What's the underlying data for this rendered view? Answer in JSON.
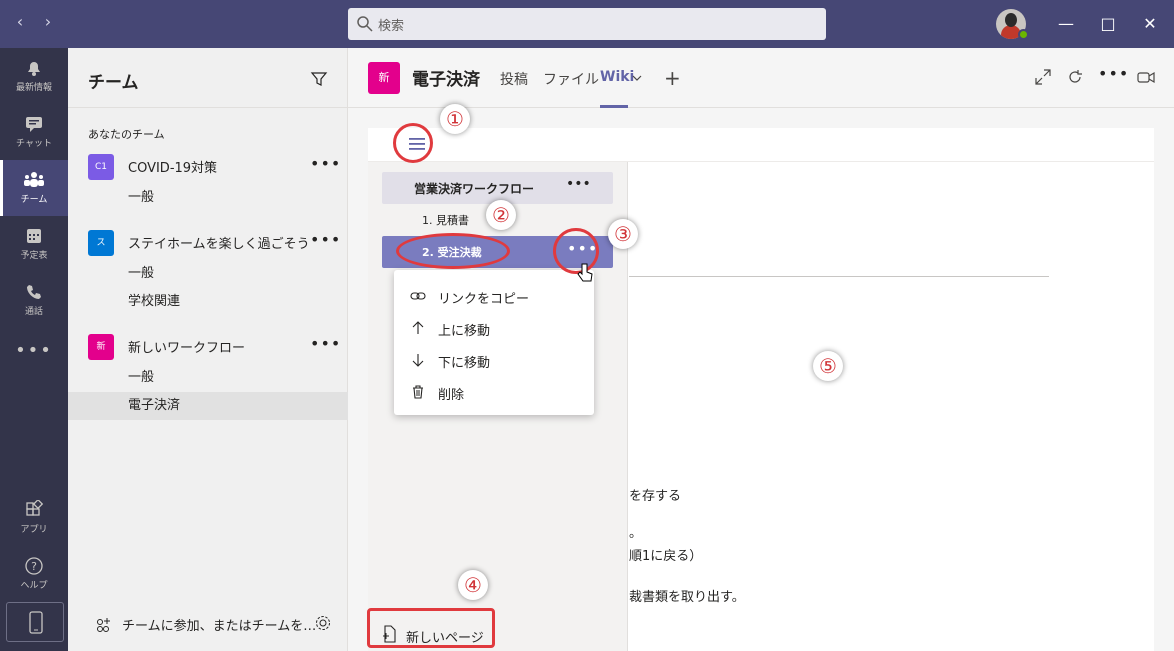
{
  "titlebar": {
    "search_placeholder": "検索",
    "colors": {
      "bar": "#464775"
    }
  },
  "rail": {
    "items": [
      {
        "label": "最新情報",
        "icon": "bell-icon"
      },
      {
        "label": "チャット",
        "icon": "chat-icon"
      },
      {
        "label": "チーム",
        "icon": "teams-icon"
      },
      {
        "label": "予定表",
        "icon": "calendar-icon"
      },
      {
        "label": "通話",
        "icon": "phone-icon"
      },
      {
        "label": "アプリ",
        "icon": "apps-icon"
      },
      {
        "label": "ヘルプ",
        "icon": "help-icon"
      }
    ],
    "active": "チーム"
  },
  "teams_panel": {
    "title": "チーム",
    "section_label": "あなたのチーム",
    "teams": [
      {
        "badge": "C1",
        "badge_color": "#7b5be5",
        "name": "COVID-19対策",
        "channels": [
          "一般"
        ]
      },
      {
        "badge": "ス",
        "badge_color": "#0078d4",
        "name": "ステイホームを楽しく過ごそう",
        "channels": [
          "一般",
          "学校関連"
        ]
      },
      {
        "badge": "新",
        "badge_color": "#e3008c",
        "name": "新しいワークフロー",
        "channels": [
          "一般",
          "電子決済"
        ]
      }
    ],
    "selected_channel": "電子決済",
    "footer_text": "チームに参加、またはチームを…"
  },
  "main_header": {
    "badge": "新",
    "channel_title": "電子決済",
    "tabs": [
      {
        "label": "投稿"
      },
      {
        "label": "ファイル"
      },
      {
        "label": "Wiki"
      }
    ],
    "active_tab": "Wiki",
    "add_tab_symbol": "+"
  },
  "wiki": {
    "section_title": "営業決済ワークフロー",
    "pages": [
      {
        "label": "1. 見積書"
      },
      {
        "label": "2. 受注決裁"
      }
    ],
    "active_page": "2. 受注決裁",
    "context_menu": [
      {
        "label": "リンクをコピー",
        "icon": "link-icon"
      },
      {
        "label": "上に移動",
        "icon": "arrow-up-icon"
      },
      {
        "label": "下に移動",
        "icon": "arrow-down-icon"
      },
      {
        "label": "削除",
        "icon": "trash-icon"
      }
    ],
    "new_page_label": "新しいページ",
    "content_lines": [
      "を存する",
      "。",
      "順1に戻る）",
      "裁書類を取り出す。"
    ]
  },
  "annotations": [
    "①",
    "②",
    "③",
    "④",
    "⑤"
  ],
  "colors": {
    "accent": "#6264a7",
    "annotation": "#e03a3e",
    "rail": "#33344a"
  }
}
